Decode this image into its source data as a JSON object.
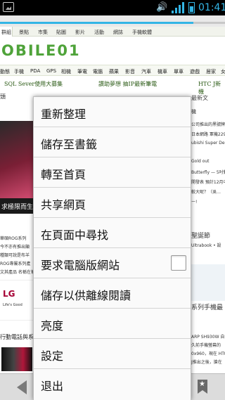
{
  "status_bar": {
    "time": "01:41",
    "signal_icon": "signal-icon",
    "battery_icon": "battery-icon",
    "volume_icon": "volume-icon"
  },
  "browser": {
    "progress": 0.86,
    "accent": "#33b5e5"
  },
  "webpage": {
    "top_nav": [
      "群組",
      "景點",
      "市集",
      "貼圖",
      "影片",
      "活動",
      "網誌",
      "手機軟體"
    ],
    "logo": "OBILE01",
    "category_nav": [
      "動態",
      "手機",
      "PDA",
      "GPS",
      "相機",
      "筆電",
      "電腦",
      "蘋果",
      "影音",
      "汽車",
      "機車",
      "單車",
      "遊戲",
      "居家",
      "女"
    ],
    "headlines": [
      "SQL Sever使用大募集",
      "讚助夢想 抽IP最新筆電",
      "HTC J新機"
    ],
    "left": {
      "corner": "頭",
      "promo": "求極限而生",
      "lines": [
        "華碩ROG系列",
        "今不亦有推出顯",
        "種類可說是布羊",
        "ROG專屬系列產",
        "文其產品 名稱在華"
      ],
      "lg_brand": "LG",
      "lg_tagline": "Life's Good",
      "section": "行動電話與系"
    },
    "right": {
      "title": "最新文",
      "sub": "機",
      "lines": [
        "公司推出的黑號牌",
        "日本網路 軍機2290",
        "ubishi Super Deli",
        "Gold out",
        "Butterfly — 5吋對",
        "開發表 預計12月中",
        "較大呢？（吳…",
        "ー!"
      ],
      "section1": "聖誕節",
      "section1_sub": "Ultrabook • 設",
      "section2": "系列手機最",
      "lines2": [
        "ARP SH930W 自",
        "久前手機螢幕的",
        "0x960，現在 HTC",
        "J推出之後，搶在"
      ]
    }
  },
  "menu": {
    "items": [
      {
        "label": "重新整理"
      },
      {
        "label": "儲存至書籤"
      },
      {
        "label": "轉至首頁"
      },
      {
        "label": "共享網頁"
      },
      {
        "label": "在頁面中尋找"
      },
      {
        "label": "要求電腦版網站",
        "checkbox": false
      },
      {
        "label": "儲存以供離線閱讀"
      },
      {
        "label": "亮度"
      },
      {
        "label": "設定"
      },
      {
        "label": "退出"
      }
    ]
  },
  "bottom_bar": {
    "back_icon": "back-arrow-icon",
    "bookmark_icon": "bookmark-icon"
  }
}
